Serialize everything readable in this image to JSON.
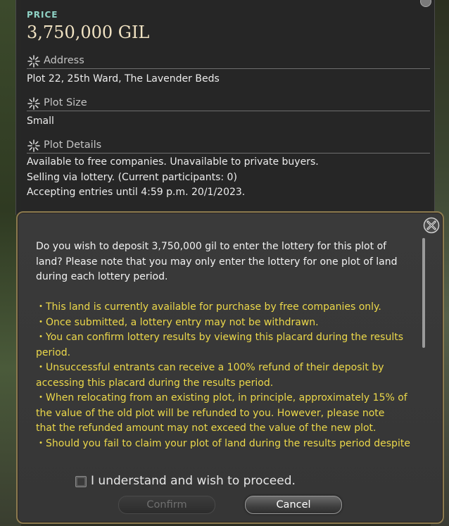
{
  "price": {
    "label": "PRICE",
    "value": "3,750,000 GIL"
  },
  "address": {
    "heading": "Address",
    "value": "Plot 22, 25th Ward, The Lavender Beds"
  },
  "plot_size": {
    "heading": "Plot Size",
    "value": "Small"
  },
  "plot_details": {
    "heading": "Plot Details",
    "lines": [
      "Available to free companies. Unavailable to private buyers.",
      "Selling via lottery. (Current participants: 0)",
      "Accepting entries until 4:59 p.m. 20/1/2023."
    ]
  },
  "dialog": {
    "message_lines": [
      "Do you wish to deposit 3,750,000 gil to enter the lottery for this plot of",
      "land? Please note that you may only enter the lottery for one plot of land",
      "during each lottery period."
    ],
    "notes_lines": [
      "・This land is currently available for purchase by free companies only.",
      "・Once submitted, a lottery entry may not be withdrawn.",
      "・You can confirm lottery results by viewing this placard during the results",
      "period.",
      "・Unsuccessful entrants can receive a 100% refund of their deposit by",
      "accessing this placard during the results period.",
      "・When relocating from an existing plot, in principle, approximately 15% of",
      "the value of the old plot will be refunded to you. However, please note",
      "that the refunded amount may not exceed the value of the new plot.",
      "・Should you fail to claim your plot of land during the results period despite"
    ],
    "checkbox_label": "I understand and wish to proceed.",
    "checkbox_checked": false,
    "confirm_label": "Confirm",
    "cancel_label": "Cancel"
  },
  "colors": {
    "price_label": "#8fd3c6",
    "notes_text": "#ecd84a",
    "dialog_border": "#8c7a4f"
  }
}
